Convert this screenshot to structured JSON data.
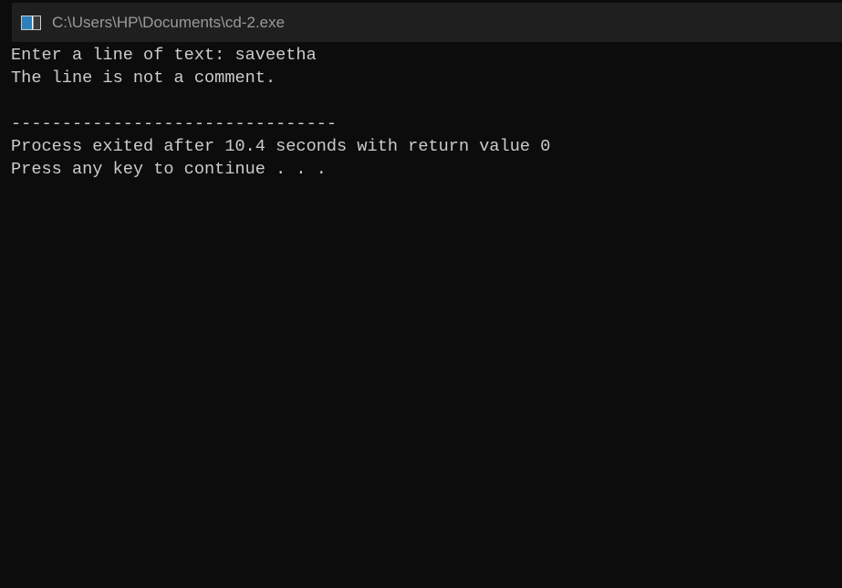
{
  "window": {
    "title": "C:\\Users\\HP\\Documents\\cd-2.exe",
    "icon": "console-app-icon"
  },
  "console": {
    "lines": [
      "Enter a line of text: saveetha",
      "The line is not a comment.",
      "",
      "--------------------------------",
      "Process exited after 10.4 seconds with return value 0",
      "Press any key to continue . . ."
    ]
  }
}
